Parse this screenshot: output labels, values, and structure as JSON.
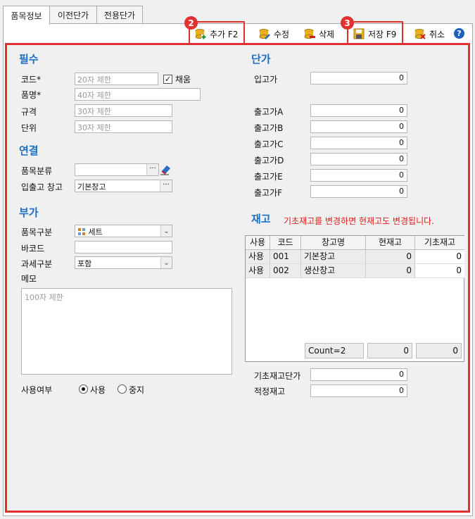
{
  "tabs": [
    {
      "label": "품목정보",
      "active": true
    },
    {
      "label": "이전단가",
      "active": false
    },
    {
      "label": "전용단가",
      "active": false
    }
  ],
  "toolbar": {
    "add_label": "추가 F2",
    "edit_label": "수정",
    "delete_label": "삭제",
    "save_label": "저장 F9",
    "cancel_label": "취소",
    "help_label": "?",
    "badge_add": "2",
    "badge_save": "3"
  },
  "required": {
    "title": "필수",
    "code_label": "코드*",
    "code_placeholder": "20자 제한",
    "auto_label": "채움",
    "auto_checked": true,
    "name_label": "품명*",
    "name_placeholder": "40자 제한",
    "spec_label": "규격",
    "spec_placeholder": "30자 제한",
    "unit_label": "단위",
    "unit_placeholder": "30자 제한"
  },
  "link": {
    "title": "연결",
    "category_label": "품목분류",
    "category_value": "",
    "warehouse_label": "입출고 창고",
    "warehouse_value": "기본창고"
  },
  "extra": {
    "title": "부가",
    "type_label": "품목구분",
    "type_value": "세트",
    "barcode_label": "바코드",
    "barcode_value": "",
    "tax_label": "과세구분",
    "tax_value": "포함",
    "memo_label": "메모",
    "memo_placeholder": "100자 제한"
  },
  "usage": {
    "label": "사용여부",
    "opt_use": "사용",
    "opt_stop": "중지",
    "selected": "사용"
  },
  "price": {
    "title": "단가",
    "in_label": "입고가",
    "in_value": "0",
    "outA_label": "출고가A",
    "outA_value": "0",
    "outB_label": "출고가B",
    "outB_value": "0",
    "outC_label": "출고가C",
    "outC_value": "0",
    "outD_label": "출고가D",
    "outD_value": "0",
    "outE_label": "출고가E",
    "outE_value": "0",
    "outF_label": "출고가F",
    "outF_value": "0"
  },
  "stock": {
    "title": "재고",
    "notice": "기초재고를 변경하면 현재고도 변경됩니다.",
    "columns": [
      "사용",
      "코드",
      "창고명",
      "현재고",
      "기초재고"
    ],
    "rows": [
      {
        "use": "사용",
        "code": "001",
        "name": "기본창고",
        "current": "0",
        "base": "0"
      },
      {
        "use": "사용",
        "code": "002",
        "name": "생산창고",
        "current": "0",
        "base": "0"
      }
    ],
    "footer_count": "Count=2",
    "footer_current": "0",
    "footer_base": "0",
    "base_price_label": "기초재고단가",
    "base_price_value": "0",
    "proper_label": "적정재고",
    "proper_value": "0"
  },
  "colors": {
    "accent": "#1a6fc6",
    "highlight": "#e03030"
  }
}
